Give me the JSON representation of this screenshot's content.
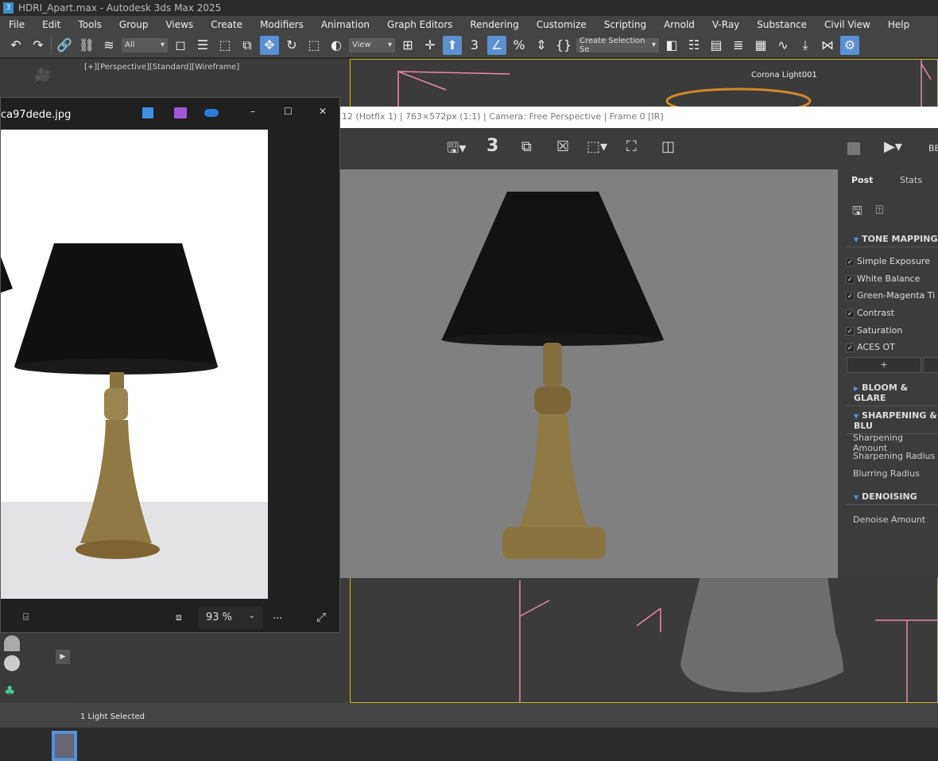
{
  "app": {
    "title": "HDRI_Apart.max - Autodesk 3ds Max 2025",
    "icon_text": "3"
  },
  "menu": [
    "File",
    "Edit",
    "Tools",
    "Group",
    "Views",
    "Create",
    "Modifiers",
    "Animation",
    "Graph Editors",
    "Rendering",
    "Customize",
    "Scripting",
    "Arnold",
    "V-Ray",
    "Substance",
    "Civil View",
    "Help"
  ],
  "toolbar": {
    "filter_value": "All",
    "view_value": "View",
    "selection_set_placeholder": "Create Selection Se",
    "snap_label": "3"
  },
  "viewport": {
    "label": "[+][Perspective][Standard][Wireframe]",
    "object_label": "Corona Light001"
  },
  "image_viewer": {
    "filename": "ca97dede.jpg",
    "zoom": "93 %",
    "more": "...",
    "min": "–",
    "max": "☐",
    "close": "✕"
  },
  "render_window": {
    "title": "12 (Hotfix 1) | 763×572px (1:1) | Camera: Free Perspective | Frame 0 [IR]",
    "beauty_label": "BE",
    "tabs": [
      "Post",
      "Stats"
    ],
    "tone_mapping": {
      "title": "TONE MAPPING",
      "items": [
        "Simple Exposure",
        "White Balance",
        "Green-Magenta Ti",
        "Contrast",
        "Saturation",
        "ACES OT"
      ],
      "add_label": "+"
    },
    "bloom": {
      "title": "BLOOM & GLARE"
    },
    "sharpening": {
      "title": "SHARPENING & BLU",
      "params": [
        "Sharpening Amount",
        "Sharpening Radius",
        "Blurring Radius"
      ]
    },
    "denoising": {
      "title": "DENOISING",
      "params": [
        "Denoise Amount"
      ]
    }
  },
  "status": {
    "text": "1 Light Selected"
  },
  "colors": {
    "accent": "#5b8fd0",
    "viewport_border": "#c7b62a",
    "wire": "#e58aa8"
  }
}
